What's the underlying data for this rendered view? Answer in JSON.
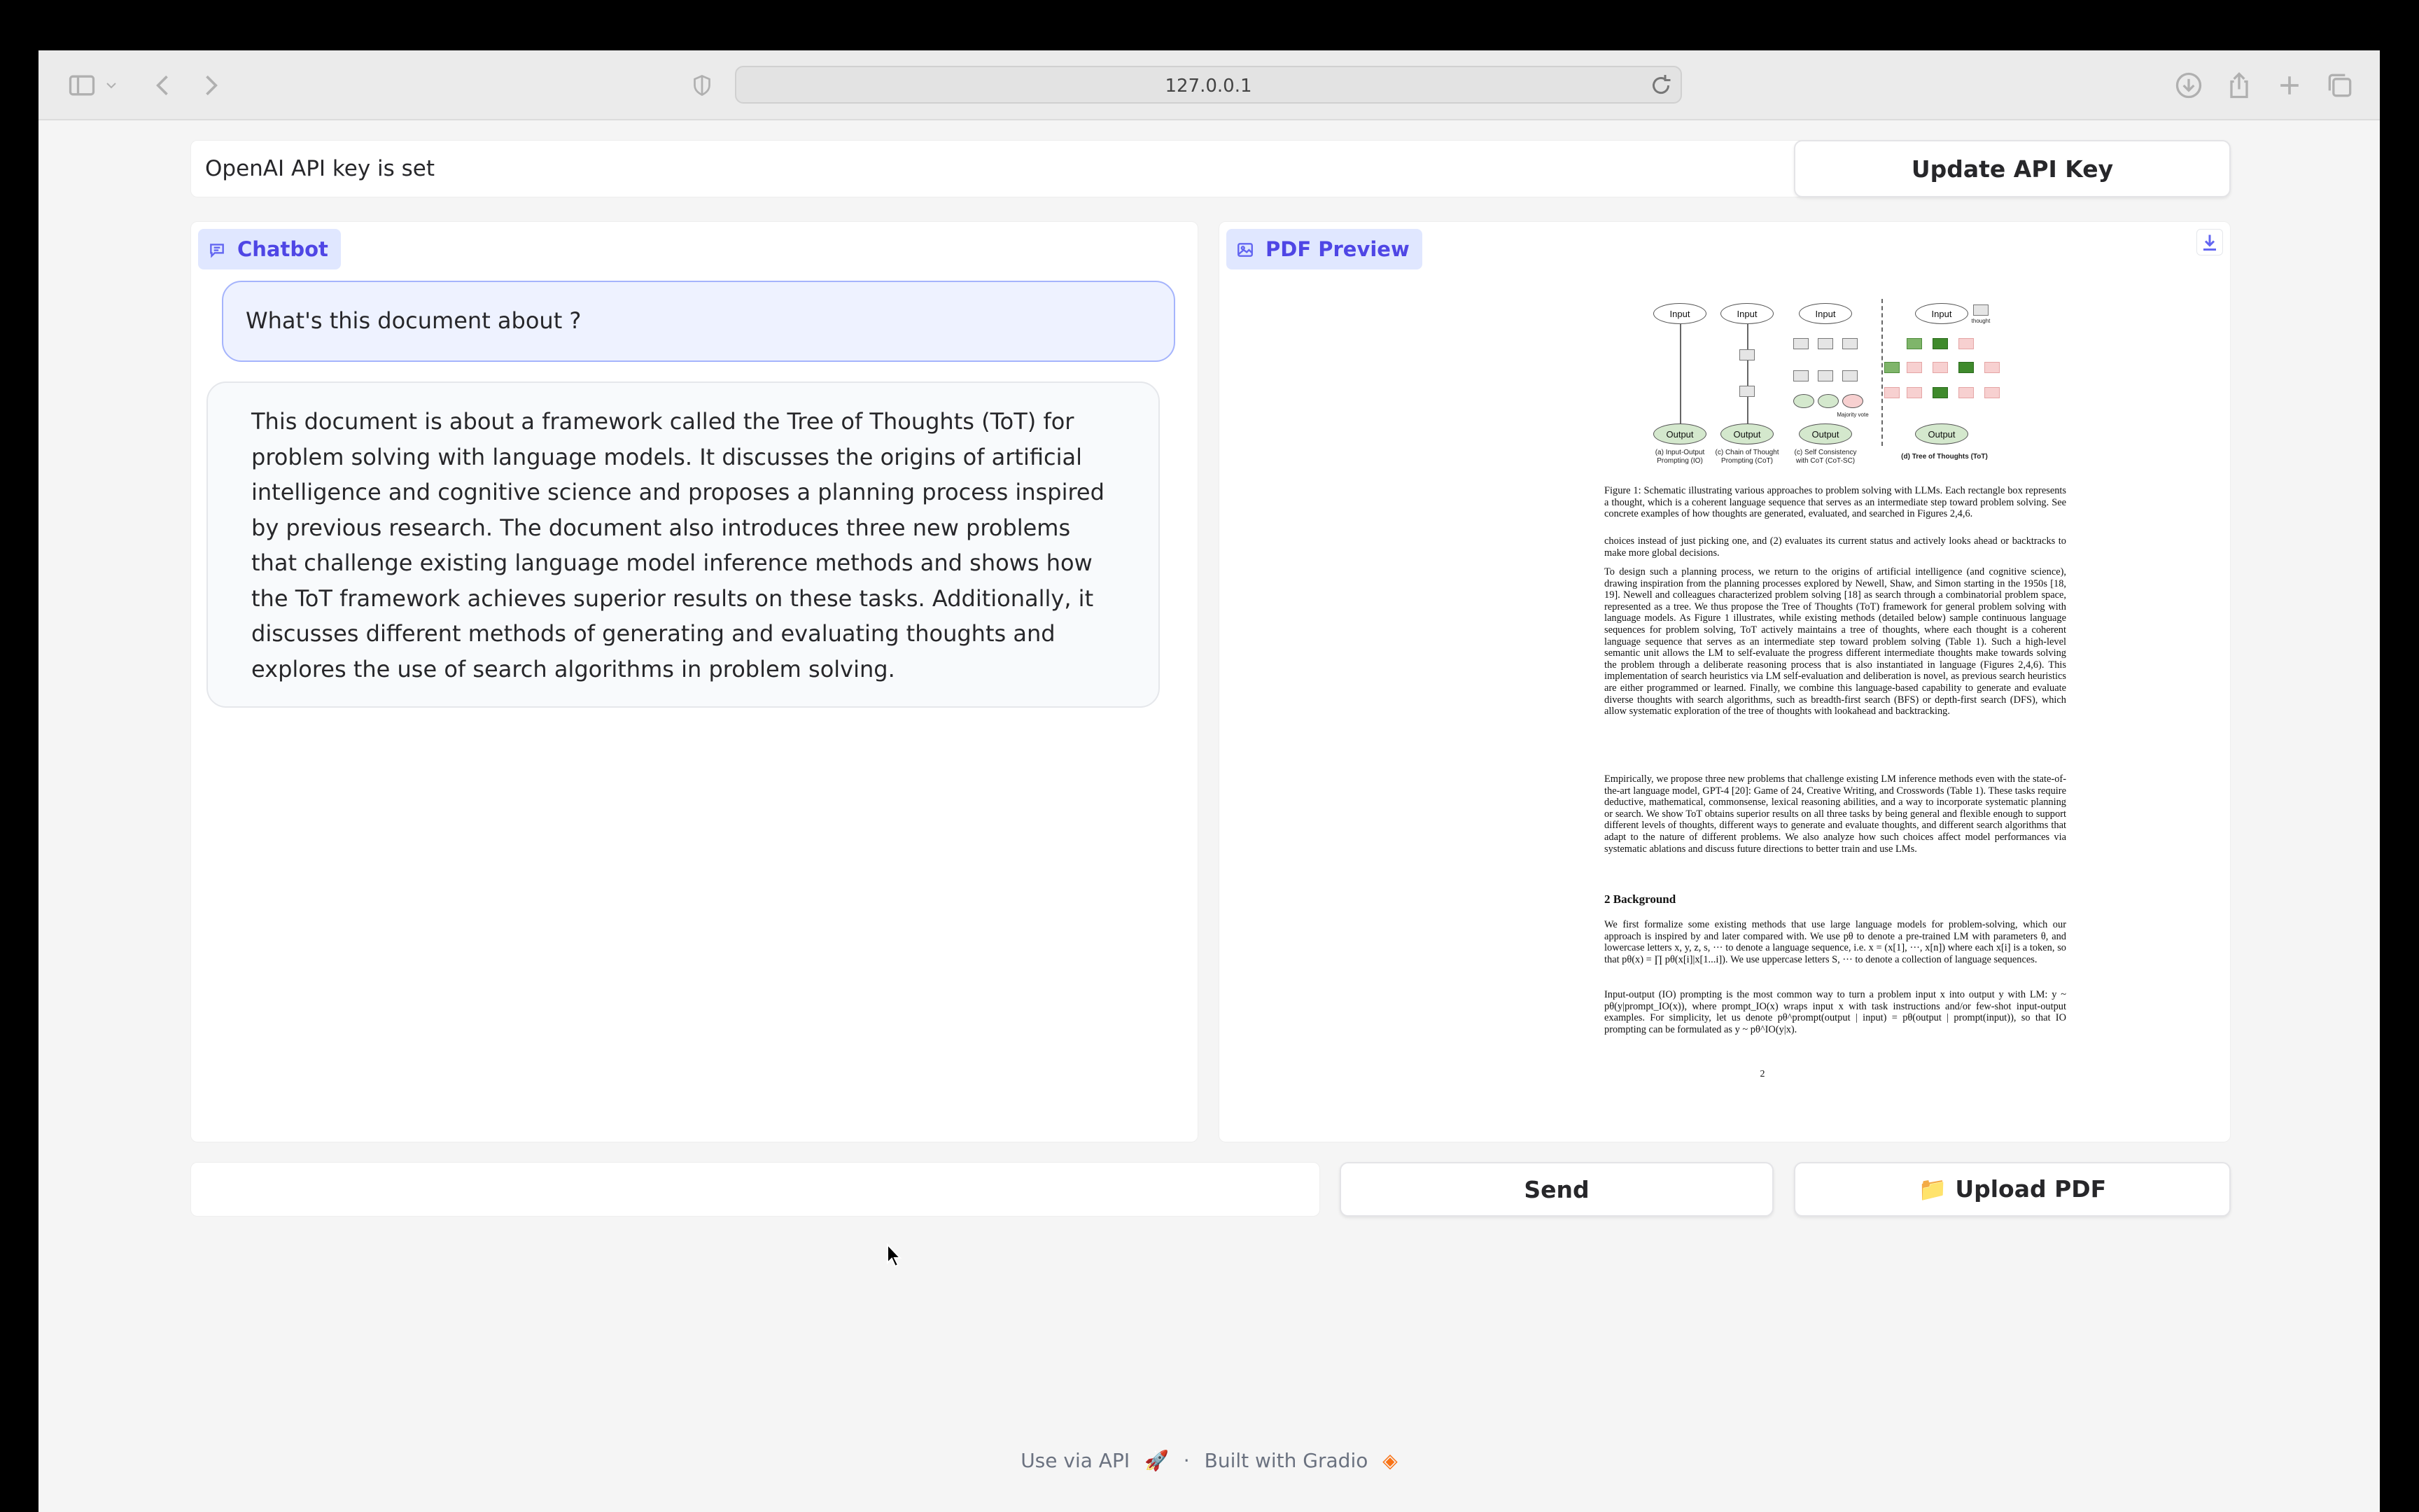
{
  "browser": {
    "url": "127.0.0.1"
  },
  "api": {
    "status": "OpenAI API key is set",
    "update_label": "Update API Key"
  },
  "chat": {
    "label": "Chatbot",
    "messages": [
      {
        "role": "user",
        "text": "What's this document about ?"
      },
      {
        "role": "bot",
        "text": "This document is about a framework called the Tree of Thoughts (ToT) for problem solving with language models. It discusses the origins of artificial intelligence and cognitive science and proposes a planning process inspired by previous research. The document also introduces three new problems that challenge existing language model inference methods and shows how the ToT framework achieves superior results on these tasks. Additionally, it discusses different methods of generating and evaluating thoughts and explores the use of search algorithms in problem solving."
      }
    ]
  },
  "pdf": {
    "label": "PDF Preview",
    "page": {
      "figure": {
        "input_label": "Input",
        "output_label": "Output",
        "thought_label": "thought",
        "majority_label": "Majority vote",
        "captions": [
          "(a) Input-Output Prompting (IO)",
          "(c) Chain of Thought Prompting (CoT)",
          "(c) Self Consistency with CoT (CoT-SC)",
          "(d) Tree of Thoughts (ToT)"
        ]
      },
      "figure_caption": "Figure 1: Schematic illustrating various approaches to problem solving with LLMs. Each rectangle box represents a thought, which is a coherent language sequence that serves as an intermediate step toward problem solving. See concrete examples of how thoughts are generated, evaluated, and searched in Figures 2,4,6.",
      "para1": "choices instead of just picking one, and (2) evaluates its current status and actively looks ahead or backtracks to make more global decisions.",
      "para2": "To design such a planning process, we return to the origins of artificial intelligence (and cognitive science), drawing inspiration from the planning processes explored by Newell, Shaw, and Simon starting in the 1950s [18, 19]. Newell and colleagues characterized problem solving [18] as search through a combinatorial problem space, represented as a tree. We thus propose the Tree of Thoughts (ToT) framework for general problem solving with language models. As Figure 1 illustrates, while existing methods (detailed below) sample continuous language sequences for problem solving, ToT actively maintains a tree of thoughts, where each thought is a coherent language sequence that serves as an intermediate step toward problem solving (Table 1). Such a high-level semantic unit allows the LM to self-evaluate the progress different intermediate thoughts make towards solving the problem through a deliberate reasoning process that is also instantiated in language (Figures 2,4,6). This implementation of search heuristics via LM self-evaluation and deliberation is novel, as previous search heuristics are either programmed or learned. Finally, we combine this language-based capability to generate and evaluate diverse thoughts with search algorithms, such as breadth-first search (BFS) or depth-first search (DFS), which allow systematic exploration of the tree of thoughts with lookahead and backtracking.",
      "para3": "Empirically, we propose three new problems that challenge existing LM inference methods even with the state-of-the-art language model, GPT-4 [20]: Game of 24, Creative Writing, and Crosswords (Table 1). These tasks require deductive, mathematical, commonsense, lexical reasoning abilities, and a way to incorporate systematic planning or search. We show ToT obtains superior results on all three tasks by being general and flexible enough to support different levels of thoughts, different ways to generate and evaluate thoughts, and different search algorithms that adapt to the nature of different problems. We also analyze how such choices affect model performances via systematic ablations and discuss future directions to better train and use LMs.",
      "section_heading": "2    Background",
      "para4": "We first formalize some existing methods that use large language models for problem-solving, which our approach is inspired by and later compared with. We use pθ to denote a pre-trained LM with parameters θ, and lowercase letters x, y, z, s, ··· to denote a language sequence, i.e. x = (x[1], ···, x[n]) where each x[i] is a token, so that pθ(x) = ∏ pθ(x[i]|x[1...i]). We use uppercase letters S, ··· to denote a collection of language sequences.",
      "para5": "Input-output (IO) prompting is the most common way to turn a problem input x into output y with LM: y ~ pθ(y|prompt_IO(x)), where prompt_IO(x) wraps input x with task instructions and/or few-shot input-output examples. For simplicity, let us denote pθ^prompt(output | input) = pθ(output | prompt(input)), so that IO prompting can be formulated as y ~ pθ^IO(y|x).",
      "page_number": "2"
    }
  },
  "composer": {
    "input_value": "",
    "send_label": "Send",
    "upload_label": "📁 Upload PDF"
  },
  "footer": {
    "api_label": "Use via API",
    "separator": "·",
    "built_label": "Built with Gradio"
  },
  "colors": {
    "accent": "#4f46e5",
    "label_bg": "#e0e7ff",
    "user_bubble": "#eef2ff",
    "bot_bubble": "#f8fafc"
  }
}
